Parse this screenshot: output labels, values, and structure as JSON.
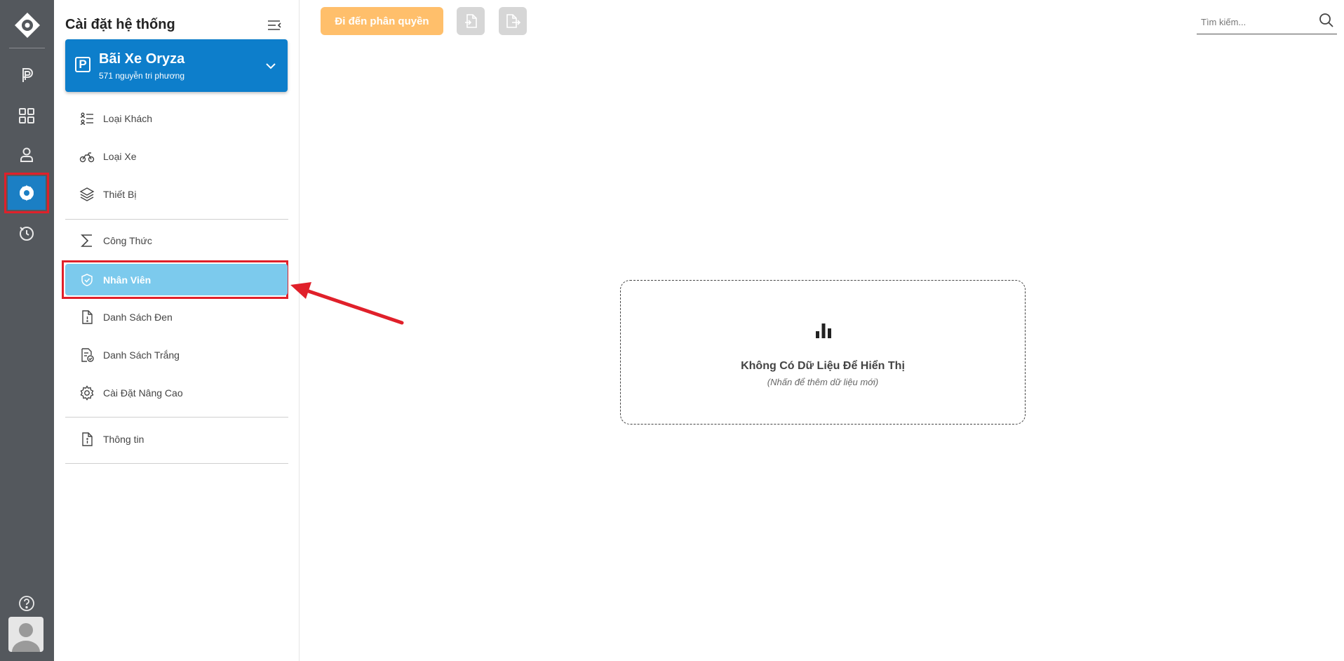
{
  "rail": {
    "items": [
      {
        "name": "parking-icon"
      },
      {
        "name": "dashboard-icon"
      },
      {
        "name": "user-icon"
      },
      {
        "name": "settings-gear-icon",
        "active": true
      },
      {
        "name": "history-icon"
      }
    ],
    "help_icon": "question-icon",
    "avatar_icon": "avatar-icon"
  },
  "panel": {
    "title": "Cài đặt hệ thống",
    "lot": {
      "badge": "P",
      "name": "Bãi Xe Oryza",
      "address": "571 nguyễn tri phương"
    },
    "groups": [
      [
        {
          "label": "Loại Khách",
          "icon": "customer-list-icon"
        },
        {
          "label": "Loại Xe",
          "icon": "motorbike-icon"
        },
        {
          "label": "Thiết Bị",
          "icon": "layers-icon"
        }
      ],
      [
        {
          "label": "Công Thức",
          "icon": "sigma-icon"
        },
        {
          "label": "Nhân Viên",
          "icon": "shield-check-icon",
          "selected": true
        },
        {
          "label": "Danh Sách Đen",
          "icon": "file-alert-icon"
        },
        {
          "label": "Danh Sách Trắng",
          "icon": "file-check-icon"
        },
        {
          "label": "Cài Đặt Nâng Cao",
          "icon": "gear-icon"
        }
      ],
      [
        {
          "label": "Thông tin",
          "icon": "file-info-icon"
        }
      ]
    ]
  },
  "toolbar": {
    "primary_label": "Đi đến phân quyền",
    "import_icon": "file-import-icon",
    "export_icon": "file-export-icon"
  },
  "search": {
    "placeholder": "Tìm kiếm..."
  },
  "empty_state": {
    "icon": "bar-chart-icon",
    "title": "Không Có Dữ Liệu Để Hiển Thị",
    "subtitle": "(Nhấn để thêm dữ liệu mới)"
  },
  "colors": {
    "rail_bg": "#54585d",
    "accent_blue": "#0d7ecb",
    "selected_item": "#7ccaed",
    "primary_button": "#ffbf6b",
    "highlight_red": "#e0202a"
  }
}
